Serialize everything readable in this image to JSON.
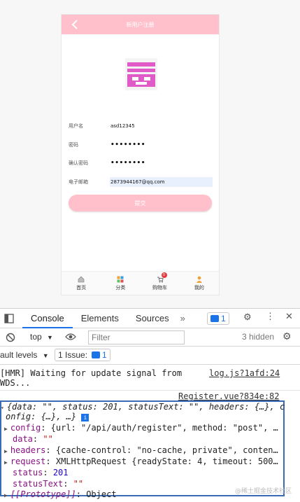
{
  "app": {
    "nav_title": "新用户注册",
    "form": {
      "rows": [
        {
          "label": "用户名",
          "value": "asd12345"
        },
        {
          "label": "密码",
          "value": "••••••••"
        },
        {
          "label": "确认密码",
          "value": "••••••••"
        },
        {
          "label": "电子邮箱",
          "value": "2873944167@qq.com"
        }
      ],
      "submit_label": "提交"
    },
    "tabs": [
      {
        "label": "首页",
        "icon": "home-icon"
      },
      {
        "label": "分类",
        "icon": "category-icon"
      },
      {
        "label": "购物车",
        "icon": "cart-icon",
        "badge": "0"
      },
      {
        "label": "我的",
        "icon": "user-icon"
      }
    ],
    "colors": {
      "accent": "#ffc0cb",
      "logo": "#e05ac8"
    }
  },
  "devtools": {
    "tabs": [
      "Console",
      "Elements",
      "Sources"
    ],
    "more_tabs": "»",
    "message_count": "1",
    "context": "top",
    "filter_placeholder": "Filter",
    "hidden": "3 hidden",
    "levels": "ault levels",
    "issue_label": "1 Issue:",
    "issue_count": "1",
    "console": {
      "hmr_line1": "[HMR] Waiting for update signal from",
      "hmr_line2": "WDS...",
      "hmr_source": "log.js?1afd:24",
      "register_source": "Register.vue?834e:82",
      "summary_line1": "{data: \"\", status: 201, statusText: \"\", headers: {…}, c",
      "summary_line2": "onfig: {…}, …}",
      "props": [
        {
          "key": "config",
          "value": "{url: \"/api/auth/register\", method: \"post\", …",
          "expandable": true
        },
        {
          "key": "data",
          "value": "\"\"",
          "expandable": false
        },
        {
          "key": "headers",
          "value": "{cache-control: \"no-cache, private\", conten…",
          "expandable": true
        },
        {
          "key": "request",
          "value": "XMLHttpRequest {readyState: 4, timeout: 500…",
          "expandable": true
        },
        {
          "key": "status",
          "value": "201",
          "expandable": false
        },
        {
          "key": "statusText",
          "value": "\"\"",
          "expandable": false
        },
        {
          "key": "[[Prototype]]",
          "value": "Object",
          "expandable": true
        }
      ]
    },
    "watermark": "@稀土掘金技术社区",
    "colors": {
      "active_tab": "#1a73e8",
      "highlight_box": "#3b6bb5"
    }
  }
}
